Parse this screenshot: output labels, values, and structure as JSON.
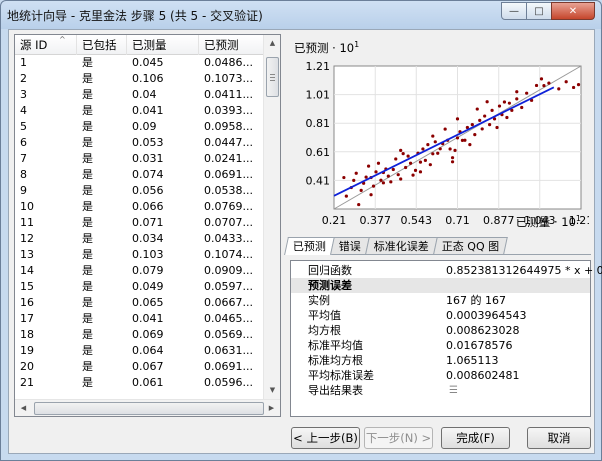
{
  "window": {
    "title": "地统计向导 - 克里金法 步骤 5 (共 5 - 交叉验证)",
    "minimize_glyph": "—",
    "maximize_glyph": "□",
    "close_glyph": "✕"
  },
  "table": {
    "columns": [
      "源 ID",
      "已包括",
      "已测量",
      "已预测"
    ],
    "rows": [
      [
        "1",
        "是",
        "0.045",
        "0.0486..."
      ],
      [
        "2",
        "是",
        "0.106",
        "0.1073..."
      ],
      [
        "3",
        "是",
        "0.04",
        "0.0411..."
      ],
      [
        "4",
        "是",
        "0.041",
        "0.0393..."
      ],
      [
        "5",
        "是",
        "0.09",
        "0.0958..."
      ],
      [
        "6",
        "是",
        "0.053",
        "0.0447..."
      ],
      [
        "7",
        "是",
        "0.031",
        "0.0241..."
      ],
      [
        "8",
        "是",
        "0.074",
        "0.0691..."
      ],
      [
        "9",
        "是",
        "0.056",
        "0.0538..."
      ],
      [
        "10",
        "是",
        "0.066",
        "0.0769..."
      ],
      [
        "11",
        "是",
        "0.071",
        "0.0707..."
      ],
      [
        "12",
        "是",
        "0.034",
        "0.0433..."
      ],
      [
        "13",
        "是",
        "0.103",
        "0.1074..."
      ],
      [
        "14",
        "是",
        "0.079",
        "0.0909..."
      ],
      [
        "15",
        "是",
        "0.049",
        "0.0597..."
      ],
      [
        "16",
        "是",
        "0.065",
        "0.0667..."
      ],
      [
        "17",
        "是",
        "0.041",
        "0.0465..."
      ],
      [
        "18",
        "是",
        "0.069",
        "0.0569..."
      ],
      [
        "19",
        "是",
        "0.064",
        "0.0631..."
      ],
      [
        "20",
        "是",
        "0.067",
        "0.0691..."
      ],
      [
        "21",
        "是",
        "0.061",
        "0.0596..."
      ]
    ]
  },
  "chart_labels": {
    "ylabel": "已预测",
    "xlabel": "已测量",
    "exp_prefix": "· 10",
    "exp": "1"
  },
  "chart_data": {
    "type": "scatter",
    "xlabel": "已测量",
    "ylabel": "已预测",
    "axis_scale": "×10^1",
    "xlim": [
      0.21,
      1.21
    ],
    "ylim": [
      0.21,
      1.21
    ],
    "x_ticks": [
      "0.21",
      "0.377",
      "0.543",
      "0.71",
      "0.877",
      "1.043",
      "1.21"
    ],
    "y_ticks": [
      "1.21",
      "1.01",
      "0.81",
      "0.61",
      "0.41"
    ],
    "grid": true,
    "reference_line": {
      "name": "1:1",
      "points": [
        [
          0.21,
          0.21
        ],
        [
          1.21,
          1.21
        ]
      ],
      "color": "#9a9a9a"
    },
    "regression_line": {
      "points": [
        [
          0.21,
          0.3025
        ],
        [
          1.1,
          1.0613
        ]
      ],
      "color": "#0f22d8"
    },
    "point_color": "#8b0000",
    "points": [
      [
        0.45,
        0.486
      ],
      [
        1.06,
        1.073
      ],
      [
        0.4,
        0.411
      ],
      [
        0.41,
        0.393
      ],
      [
        0.9,
        0.958
      ],
      [
        0.53,
        0.447
      ],
      [
        0.31,
        0.241
      ],
      [
        0.74,
        0.691
      ],
      [
        0.56,
        0.538
      ],
      [
        0.66,
        0.769
      ],
      [
        0.71,
        0.707
      ],
      [
        0.34,
        0.433
      ],
      [
        1.03,
        1.074
      ],
      [
        0.79,
        0.909
      ],
      [
        0.49,
        0.597
      ],
      [
        0.65,
        0.667
      ],
      [
        0.41,
        0.465
      ],
      [
        0.69,
        0.569
      ],
      [
        0.64,
        0.631
      ],
      [
        0.67,
        0.691
      ],
      [
        0.61,
        0.596
      ],
      [
        0.25,
        0.43
      ],
      [
        0.28,
        0.36
      ],
      [
        0.3,
        0.46
      ],
      [
        0.32,
        0.34
      ],
      [
        0.33,
        0.39
      ],
      [
        0.35,
        0.51
      ],
      [
        0.36,
        0.43
      ],
      [
        0.37,
        0.37
      ],
      [
        0.38,
        0.47
      ],
      [
        0.39,
        0.53
      ],
      [
        0.42,
        0.49
      ],
      [
        0.43,
        0.44
      ],
      [
        0.44,
        0.4
      ],
      [
        0.46,
        0.56
      ],
      [
        0.47,
        0.45
      ],
      [
        0.48,
        0.42
      ],
      [
        0.5,
        0.5
      ],
      [
        0.51,
        0.58
      ],
      [
        0.52,
        0.53
      ],
      [
        0.54,
        0.48
      ],
      [
        0.55,
        0.6
      ],
      [
        0.57,
        0.63
      ],
      [
        0.58,
        0.55
      ],
      [
        0.59,
        0.66
      ],
      [
        0.6,
        0.52
      ],
      [
        0.62,
        0.68
      ],
      [
        0.63,
        0.6
      ],
      [
        0.68,
        0.63
      ],
      [
        0.7,
        0.62
      ],
      [
        0.72,
        0.75
      ],
      [
        0.73,
        0.69
      ],
      [
        0.75,
        0.78
      ],
      [
        0.76,
        0.66
      ],
      [
        0.77,
        0.8
      ],
      [
        0.78,
        0.73
      ],
      [
        0.8,
        0.83
      ],
      [
        0.81,
        0.77
      ],
      [
        0.82,
        0.86
      ],
      [
        0.84,
        0.8
      ],
      [
        0.85,
        0.9
      ],
      [
        0.86,
        0.84
      ],
      [
        0.87,
        0.78
      ],
      [
        0.88,
        0.93
      ],
      [
        0.89,
        0.87
      ],
      [
        0.91,
        0.85
      ],
      [
        0.92,
        0.95
      ],
      [
        0.93,
        0.9
      ],
      [
        0.95,
        0.98
      ],
      [
        0.97,
        0.92
      ],
      [
        0.99,
        1.02
      ],
      [
        1.01,
        0.97
      ],
      [
        1.05,
        1.12
      ],
      [
        1.08,
        1.09
      ],
      [
        1.12,
        1.05
      ],
      [
        1.15,
        1.1
      ],
      [
        1.18,
        1.06
      ],
      [
        1.2,
        1.08
      ],
      [
        0.26,
        0.3
      ],
      [
        0.29,
        0.41
      ],
      [
        0.36,
        0.31
      ],
      [
        0.48,
        0.62
      ],
      [
        0.61,
        0.72
      ],
      [
        0.83,
        0.96
      ],
      [
        0.95,
        1.03
      ],
      [
        0.71,
        0.84
      ],
      [
        0.56,
        0.47
      ],
      [
        0.69,
        0.54
      ]
    ]
  },
  "tabs": [
    "已预测",
    "错误",
    "标准化误差",
    "正态 QQ 图"
  ],
  "stats": {
    "regression": {
      "label": "回归函数",
      "value": "0.852381312644975 * x + 0..."
    },
    "section": "预测误差",
    "rows": [
      {
        "label": "实例",
        "value": "167 的 167"
      },
      {
        "label": "平均值",
        "value": "0.0003964543"
      },
      {
        "label": "均方根",
        "value": "0.008623028"
      },
      {
        "label": "标准平均值",
        "value": "0.01678576"
      },
      {
        "label": "标准均方根",
        "value": "1.065113"
      },
      {
        "label": "平均标准误差",
        "value": "0.008602481"
      },
      {
        "label": "导出结果表",
        "value": ""
      }
    ]
  },
  "buttons": {
    "back": "< 上一步(B)",
    "next": "下一步(N) >",
    "finish": "完成(F)",
    "cancel": "取消"
  }
}
